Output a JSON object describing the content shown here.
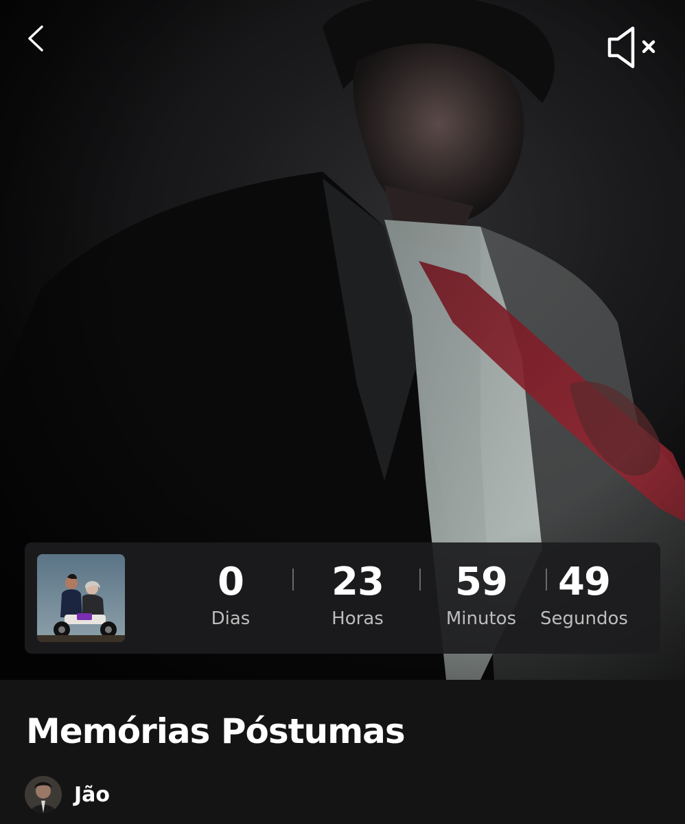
{
  "hero": {
    "image": "dark portrait of a man in a suit loosening a red tie",
    "back_icon": "chevron-left-icon",
    "mute_icon": "speaker-muted-icon"
  },
  "countdown": {
    "cover_image": "album cover: man and older woman riding a motorcycle",
    "units": [
      {
        "value": "0",
        "label": "Dias"
      },
      {
        "value": "23",
        "label": "Horas"
      },
      {
        "value": "59",
        "label": "Minutos"
      },
      {
        "value": "49",
        "label": "Segundos"
      }
    ]
  },
  "release": {
    "title": "Memórias Póstumas",
    "artist": "Jão"
  },
  "colors": {
    "background": "#141414",
    "card": "#1c1c1e",
    "label_gray": "#bdbdbd",
    "tie_red": "#8a1f2a"
  }
}
